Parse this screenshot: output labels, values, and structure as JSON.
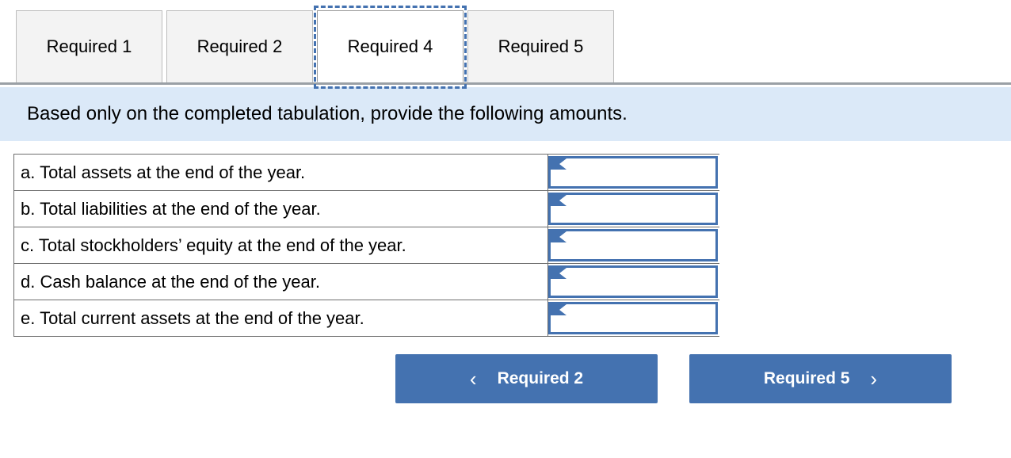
{
  "tabs": [
    {
      "label": "Required 1",
      "active": false
    },
    {
      "label": "Required 2",
      "active": false
    },
    {
      "label": "Required 4",
      "active": true
    },
    {
      "label": "Required 5",
      "active": false
    }
  ],
  "banner": {
    "text": "Based only on the completed tabulation, provide the following amounts."
  },
  "table": {
    "rows": [
      {
        "label": "a. Total assets at the end of the year.",
        "value": ""
      },
      {
        "label": "b. Total liabilities at the end of the year.",
        "value": ""
      },
      {
        "label": "c. Total stockholders’ equity at the end of the year.",
        "value": ""
      },
      {
        "label": "d. Cash balance at the end of the year.",
        "value": ""
      },
      {
        "label": "e. Total current assets at the end of the year.",
        "value": ""
      }
    ]
  },
  "navigation": {
    "prev_label": "Required 2",
    "prev_icon": "chevron-left-icon",
    "prev_glyph": "‹",
    "next_label": "Required 5",
    "next_icon": "chevron-right-icon",
    "next_glyph": "›"
  },
  "colors": {
    "accent_blue": "#4472b0",
    "banner_blue": "#dbe9f8",
    "tab_inactive": "#f3f3f3",
    "border_gray": "#6e6e6e"
  }
}
